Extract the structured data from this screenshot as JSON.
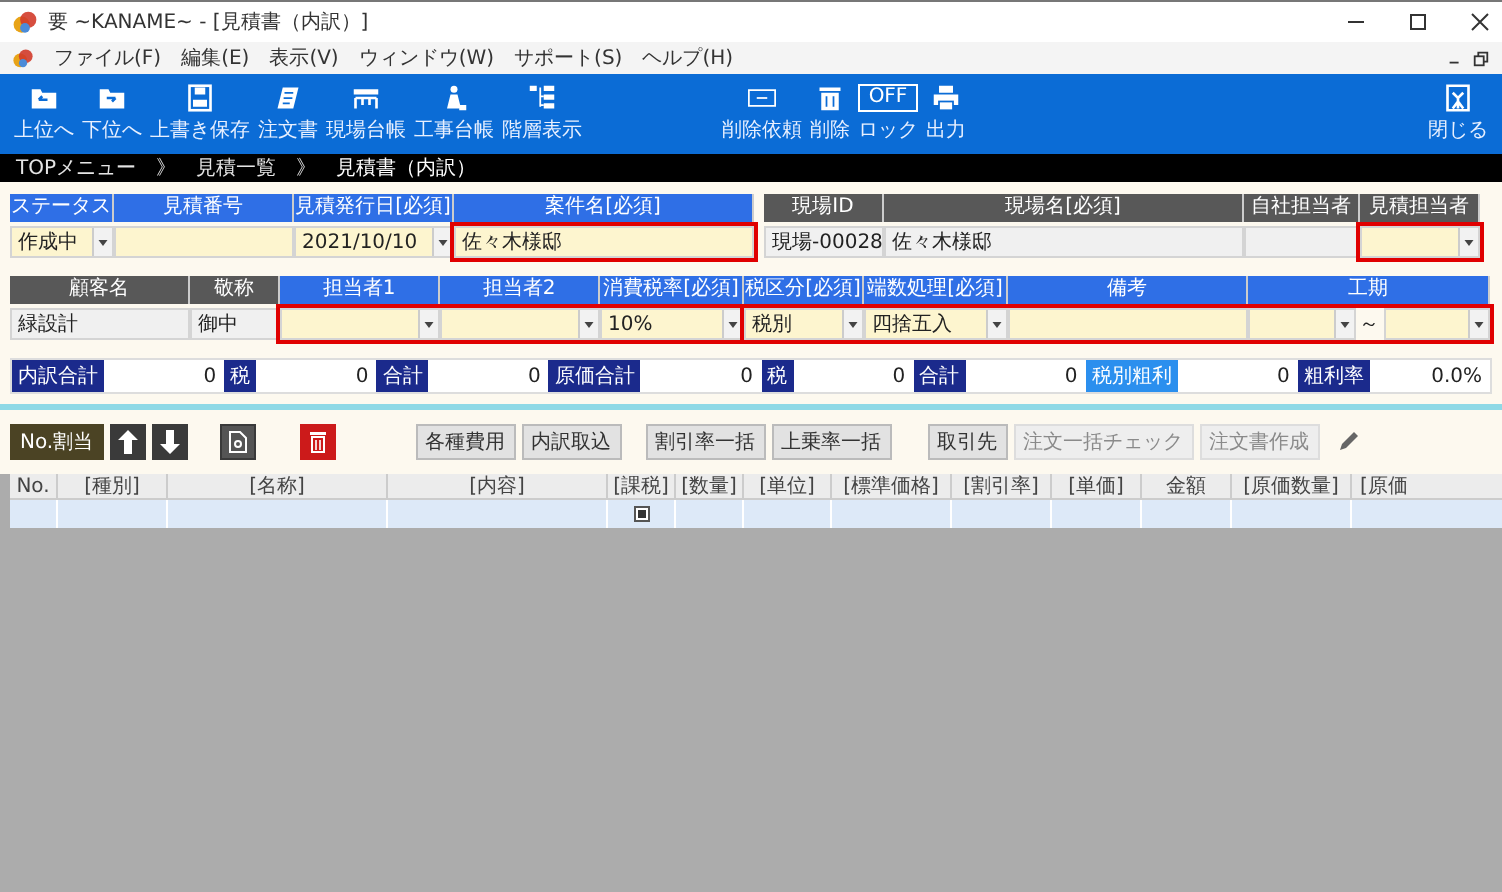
{
  "window": {
    "title": "要 ~KANAME~ - [見積書（内訳）]"
  },
  "menu": [
    "ファイル(F)",
    "編集(E)",
    "表示(V)",
    "ウィンドウ(W)",
    "サポート(S)",
    "ヘルプ(H)"
  ],
  "toolbar": {
    "left": [
      {
        "kind": "up",
        "label": "上位へ"
      },
      {
        "kind": "down",
        "label": "下位へ"
      },
      {
        "kind": "save",
        "label": "上書き保存"
      },
      {
        "kind": "order",
        "label": "注文書"
      },
      {
        "kind": "site",
        "label": "現場台帳"
      },
      {
        "kind": "work",
        "label": "工事台帳"
      },
      {
        "kind": "tree",
        "label": "階層表示"
      }
    ],
    "center": [
      {
        "kind": "request",
        "label": "削除依頼"
      },
      {
        "kind": "delete",
        "label": "削除"
      },
      {
        "kind": "lock",
        "label": "ロック",
        "badge": "OFF"
      },
      {
        "kind": "print",
        "label": "出力"
      }
    ],
    "right": [
      {
        "kind": "close",
        "label": "閉じる"
      }
    ]
  },
  "breadcrumb": [
    {
      "kind": "link",
      "label": "TOPメニュー"
    },
    {
      "kind": "separator",
      "label": "》"
    },
    {
      "kind": "link",
      "label": "見積一覧"
    },
    {
      "kind": "separator",
      "label": "》"
    },
    {
      "kind": "current",
      "label": "見積書（内訳）"
    }
  ],
  "form": {
    "rows": [
      {
        "groups": [
          {
            "kind": "input",
            "highlighted": false,
            "fields": [
              {
                "header": "ステータス",
                "kind": "select",
                "editable": true,
                "value": "作成中"
              },
              {
                "header": "見積番号",
                "kind": "text",
                "editable": true
              },
              {
                "header": "見積発行日[必須]",
                "kind": "select",
                "editable": true,
                "value": "2021/10/10"
              }
            ]
          },
          {
            "kind": "input",
            "highlighted": true,
            "fields": [
              {
                "header": "案件名[必須]",
                "kind": "text",
                "editable": true,
                "value": "佐々木様邸"
              }
            ]
          },
          {
            "kind": "readonly",
            "highlighted": false,
            "fields": [
              {
                "header": "現場ID",
                "kind": "text",
                "editable": false,
                "value": "現場-00028"
              },
              {
                "header": "現場名[必須]",
                "kind": "text",
                "editable": false,
                "value": "佐々木様邸"
              },
              {
                "header": "自社担当者",
                "kind": "text",
                "editable": false
              }
            ]
          },
          {
            "kind": "readonly",
            "highlighted": true,
            "fields": [
              {
                "header": "見積担当者",
                "kind": "select",
                "editable": true
              }
            ]
          }
        ]
      },
      {
        "groups": [
          {
            "kind": "readonly",
            "highlighted": false,
            "fields": [
              {
                "header": "顧客名",
                "kind": "text",
                "editable": false,
                "value": "緑設計"
              },
              {
                "header": "敬称",
                "kind": "text",
                "editable": false,
                "value": "御中"
              }
            ]
          },
          {
            "kind": "input",
            "highlighted": true,
            "fields": [
              {
                "header": "担当者1",
                "kind": "select",
                "editable": true
              },
              {
                "header": "担当者2",
                "kind": "select",
                "editable": true
              },
              {
                "header": "消費税率[必須]",
                "kind": "select",
                "editable": true,
                "value": "10%"
              }
            ]
          },
          {
            "kind": "input",
            "highlighted": true,
            "fields": [
              {
                "header": "税区分[必須]",
                "kind": "select",
                "editable": true,
                "value": "税別"
              },
              {
                "header": "端数処理[必須]",
                "kind": "select",
                "editable": true,
                "value": "四捨五入"
              },
              {
                "header": "備考",
                "kind": "text",
                "editable": true
              },
              {
                "header": "工期",
                "kind": "range",
                "editable": true,
                "separator": "～"
              }
            ]
          }
        ]
      }
    ],
    "totals": [
      {
        "kind": "label",
        "label": "内訳合計",
        "value": "0"
      },
      {
        "kind": "label",
        "label": "税",
        "value": "0"
      },
      {
        "kind": "label",
        "label": "合計",
        "value": "0"
      },
      {
        "kind": "label",
        "label": "原価合計",
        "value": "0"
      },
      {
        "kind": "label",
        "label": "税",
        "value": "0"
      },
      {
        "kind": "label",
        "label": "合計",
        "value": "0"
      },
      {
        "kind": "button",
        "label": "税別粗利",
        "value": "0"
      },
      {
        "kind": "label",
        "label": "粗利率",
        "value": "0.0%"
      }
    ]
  },
  "actions": [
    [
      {
        "kind": "dark",
        "label": "No.割当"
      },
      {
        "kind": "up"
      },
      {
        "kind": "down"
      }
    ],
    [
      {
        "kind": "document"
      }
    ],
    [
      {
        "kind": "trash"
      }
    ],
    [
      {
        "kind": "button",
        "label": "各種費用",
        "disabled": false
      },
      {
        "kind": "button",
        "label": "内訳取込",
        "disabled": false
      }
    ],
    [
      {
        "kind": "button",
        "label": "割引率一括",
        "disabled": false
      },
      {
        "kind": "button",
        "label": "上乗率一括",
        "disabled": false
      }
    ],
    [
      {
        "kind": "button",
        "label": "取引先",
        "disabled": false
      },
      {
        "kind": "button",
        "label": "注文一括チェック",
        "disabled": true
      },
      {
        "kind": "button",
        "label": "注文書作成",
        "disabled": true
      }
    ],
    [
      {
        "kind": "pencil"
      }
    ]
  ],
  "table": {
    "columns": [
      "No.",
      "[種別]",
      "[名称]",
      "[内容]",
      "[課税]",
      "[数量]",
      "[単位]",
      "[標準価格]",
      "[割引率]",
      "[単価]",
      "金額",
      "[原価数量]",
      "[原価"
    ],
    "rows": [
      {
        "taxable": true
      }
    ]
  }
}
